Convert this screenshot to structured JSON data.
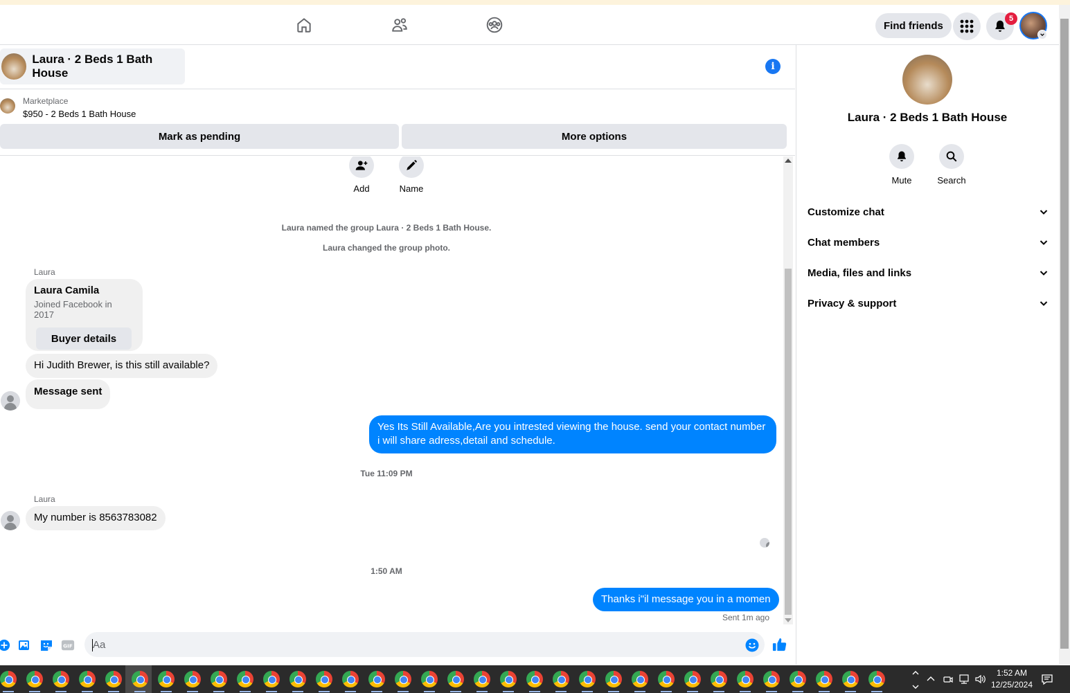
{
  "nav": {
    "tabs": [
      "home",
      "friends",
      "groups"
    ],
    "find_friends": "Find friends",
    "notification_count": "5"
  },
  "chat": {
    "title": "Laura · 2 Beds 1 Bath House",
    "listing": {
      "label": "Marketplace",
      "price_title": "$950 - 2 Beds 1 Bath House",
      "mark_pending": "Mark as pending",
      "more_options": "More options"
    },
    "actions": {
      "add": "Add",
      "name": "Name"
    },
    "system": [
      "Laura named the group Laura · 2 Beds 1 Bath House.",
      "Laura changed the group photo."
    ],
    "sender_name": "Laura",
    "buyer_card": {
      "name": "Laura Camila",
      "joined": "Joined Facebook in 2017",
      "button": "Buyer details"
    },
    "messages": {
      "m1": "Hi Judith Brewer, is this still available?",
      "m2": "Message sent",
      "m3": "Yes Its Still Available,Are you intrested viewing the house. send your contact number i will share adress,detail and schedule.",
      "ts1": "Tue 11:09 PM",
      "m4": "My number is 8563783082",
      "ts2": "1:50 AM",
      "m5": "Thanks i\"il message you in a momen",
      "status": "Sent 1m ago"
    },
    "composer_placeholder": "Aa"
  },
  "panel": {
    "title": "Laura · 2 Beds 1 Bath House",
    "mute": "Mute",
    "search": "Search",
    "sections": [
      "Customize chat",
      "Chat members",
      "Media, files and links",
      "Privacy & support"
    ]
  },
  "taskbar": {
    "time": "1:52 AM",
    "date": "12/25/2024"
  },
  "colors": {
    "accent": "#1877f2",
    "my_bubble": "#0084ff",
    "bubble": "#f0f0f0",
    "badge": "#e41e3f"
  }
}
